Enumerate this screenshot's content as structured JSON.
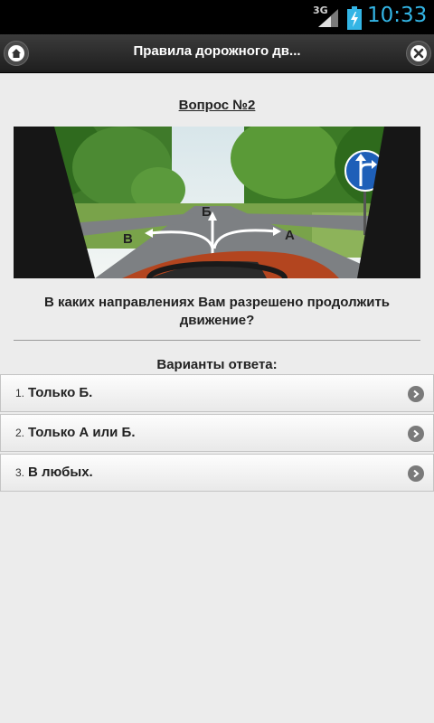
{
  "status_bar": {
    "network": "3G",
    "time": "10:33"
  },
  "header": {
    "title": "Правила дорожного дв...",
    "home_icon": "home-icon",
    "close_icon": "close-icon"
  },
  "question": {
    "number_label": "Вопрос №2",
    "image_labels": {
      "a": "А",
      "b": "Б",
      "v": "В"
    },
    "text": "В каких направлениях Вам разрешено продолжить движение?"
  },
  "answers": {
    "heading": "Варианты ответа:",
    "items": [
      {
        "num": "1.",
        "text": "Только Б."
      },
      {
        "num": "2.",
        "text": "Только А или Б."
      },
      {
        "num": "3.",
        "text": "В любых."
      }
    ]
  }
}
